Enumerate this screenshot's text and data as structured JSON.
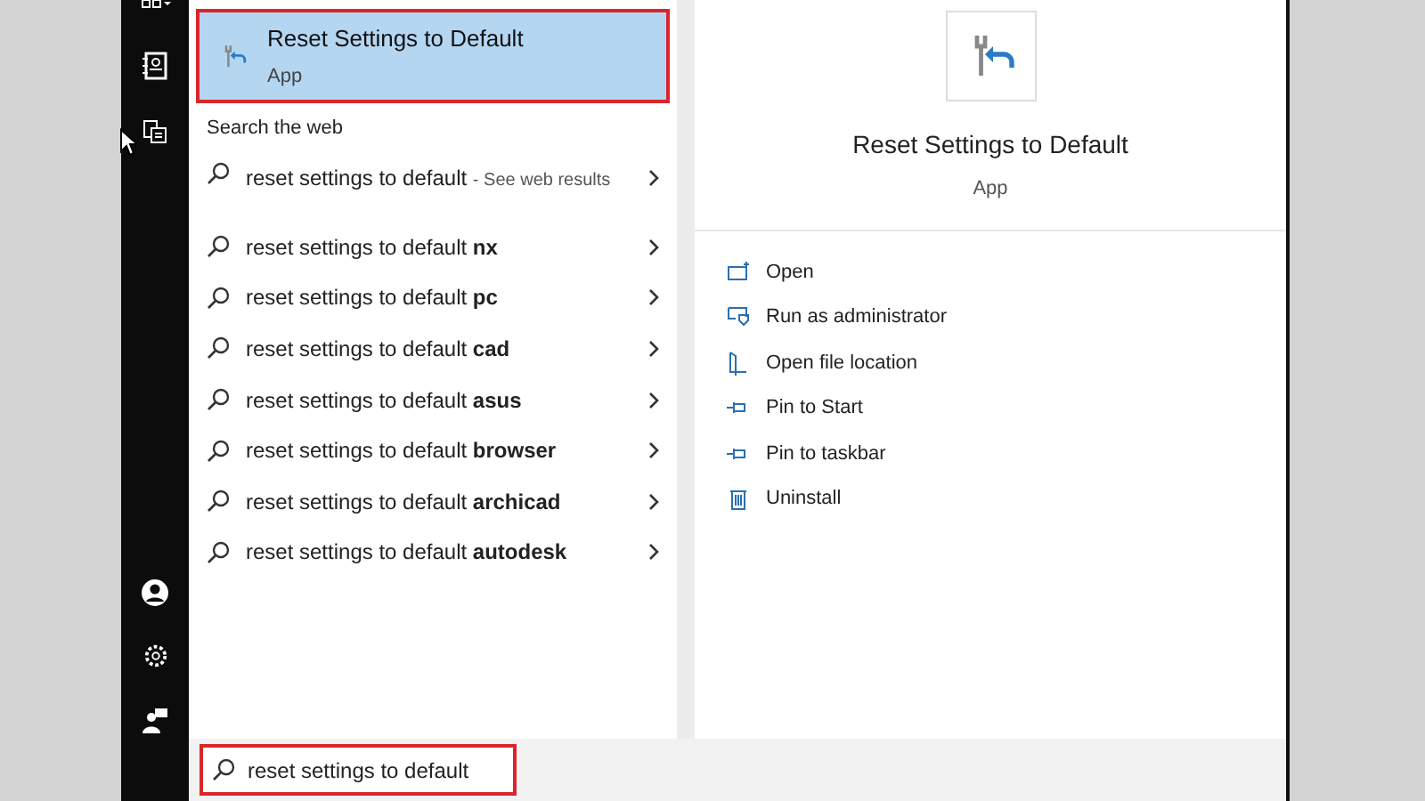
{
  "best_match": {
    "title": "Reset Settings to Default",
    "subtitle": "App",
    "selected": true
  },
  "web_heading": "Search the web",
  "suggestions": [
    {
      "text": "reset settings to default",
      "detail": "- See web results"
    },
    {
      "text": "reset settings to default **nx**"
    },
    {
      "text": "reset settings to default **pc**"
    },
    {
      "text": "reset settings to default **cad**"
    },
    {
      "text": "reset settings to default **asus**"
    },
    {
      "text": "reset settings to default **browser**"
    },
    {
      "text": "reset settings to default **archicad**"
    },
    {
      "text": "reset settings to default **autodesk**"
    }
  ],
  "preview": {
    "title": "Reset Settings to Default",
    "subtitle": "App"
  },
  "actions": [
    {
      "kind": "open",
      "label": "Open"
    },
    {
      "kind": "admin",
      "label": "Run as administrator"
    },
    {
      "kind": "folder",
      "label": "Open file location"
    },
    {
      "kind": "pin",
      "label": "Pin to Start"
    },
    {
      "kind": "pin",
      "label": "Pin to taskbar"
    },
    {
      "kind": "trash",
      "label": "Uninstall"
    }
  ],
  "search": {
    "value": "reset settings to default"
  }
}
